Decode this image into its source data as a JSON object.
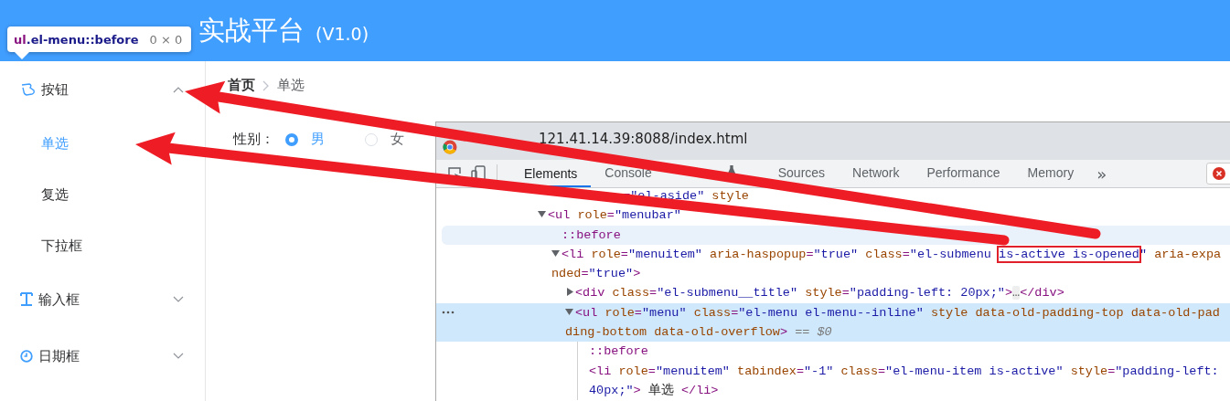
{
  "header": {
    "title": "实战平台",
    "version": "(V1.0)"
  },
  "inspect_tooltip": {
    "tag": "ul",
    "selector": ".el-menu::before",
    "size": "0 × 0"
  },
  "sidebar": {
    "items": [
      {
        "label": "按钮",
        "kind": "button",
        "expanded": true,
        "children": [
          {
            "label": "单选",
            "selected": true
          },
          {
            "label": "复选",
            "selected": false
          },
          {
            "label": "下拉框",
            "selected": false
          }
        ]
      },
      {
        "label": "输入框",
        "kind": "input",
        "expanded": false
      },
      {
        "label": "日期框",
        "kind": "date",
        "expanded": false
      }
    ]
  },
  "breadcrumb": [
    "首页",
    "单选"
  ],
  "form": {
    "label": "性别：",
    "options": [
      {
        "label": "男",
        "selected": true
      },
      {
        "label": "女",
        "selected": false
      }
    ]
  },
  "devtools": {
    "title": "121.41.14.39:8088/index.html",
    "tabs": [
      {
        "label": "Elements",
        "selected": true
      },
      {
        "label": "Console",
        "selected": false
      },
      {
        "selected": false,
        "kind": "experimental"
      },
      {
        "label": "Sources",
        "selected": false
      },
      {
        "label": "Network",
        "selected": false
      },
      {
        "label": "Performance",
        "selected": false
      },
      {
        "label": "Memory",
        "selected": false
      }
    ],
    "more": "»",
    "nodes": [
      {
        "selected": false,
        "hovered": false,
        "tokens": [
          {
            "kind": "gap"
          },
          {
            "kind": "gap"
          },
          {
            "kind": "gap"
          },
          {
            "kind": "gap"
          },
          {
            "kind": "gap"
          },
          {
            "kind": "gap"
          },
          {
            "kind": "gap"
          },
          {
            "kind": "gap"
          },
          {
            "kind": "gap"
          },
          {
            "kind": "gap"
          },
          {
            "kind": "gap"
          },
          {
            "kind": "gap"
          },
          {
            "kind": "punct",
            "text": "="
          },
          {
            "kind": "value",
            "text": "\"el-aside\""
          },
          {
            "kind": "attr",
            "text": " style"
          }
        ],
        "children": [
          {
            "expanded": true,
            "selected": false,
            "hovered": false,
            "tokens": [
              {
                "kind": "punct",
                "text": "<"
              },
              {
                "kind": "tag",
                "text": "ul"
              },
              {
                "kind": "attr",
                "text": " role"
              },
              {
                "kind": "punct",
                "text": "="
              },
              {
                "kind": "value",
                "text": "\"menubar\""
              }
            ],
            "children": [
              {
                "selected": false,
                "hovered": true,
                "tokens": [
                  {
                    "kind": "pseudo",
                    "text": "::before"
                  }
                ]
              },
              {
                "expanded": true,
                "selected": false,
                "hovered": false,
                "tokens": [
                  {
                    "kind": "punct",
                    "text": "<"
                  },
                  {
                    "kind": "tag",
                    "text": "li"
                  },
                  {
                    "kind": "attr",
                    "text": " role"
                  },
                  {
                    "kind": "punct",
                    "text": "="
                  },
                  {
                    "kind": "value",
                    "text": "\"menuitem\""
                  },
                  {
                    "kind": "attr",
                    "text": " aria-haspopup"
                  },
                  {
                    "kind": "punct",
                    "text": "="
                  },
                  {
                    "kind": "value",
                    "text": "\"true\""
                  },
                  {
                    "kind": "attr",
                    "text": " class"
                  },
                  {
                    "kind": "punct",
                    "text": "="
                  },
                  {
                    "kind": "value",
                    "text": "\"el-submenu "
                  },
                  {
                    "kind": "boxed",
                    "text": "is-active is-opened"
                  },
                  {
                    "kind": "value",
                    "text": "\""
                  },
                  {
                    "kind": "attr",
                    "text": " aria-expanded"
                  },
                  {
                    "kind": "punct",
                    "text": "="
                  },
                  {
                    "kind": "value",
                    "text": "\"true\""
                  },
                  {
                    "kind": "punct",
                    "text": ">"
                  }
                ],
                "children": [
                  {
                    "expanded": false,
                    "selected": false,
                    "hovered": false,
                    "tokens": [
                      {
                        "kind": "punct",
                        "text": "<"
                      },
                      {
                        "kind": "tag",
                        "text": "div"
                      },
                      {
                        "kind": "attr",
                        "text": " class"
                      },
                      {
                        "kind": "punct",
                        "text": "="
                      },
                      {
                        "kind": "value",
                        "text": "\"el-submenu__title\""
                      },
                      {
                        "kind": "attr",
                        "text": " style"
                      },
                      {
                        "kind": "punct",
                        "text": "="
                      },
                      {
                        "kind": "value",
                        "text": "\"padding-left: 20px;\""
                      },
                      {
                        "kind": "punct",
                        "text": ">"
                      },
                      {
                        "kind": "ellipsis",
                        "text": "…"
                      },
                      {
                        "kind": "punct",
                        "text": "</"
                      },
                      {
                        "kind": "tag",
                        "text": "div"
                      },
                      {
                        "kind": "punct",
                        "text": ">"
                      }
                    ]
                  },
                  {
                    "expanded": true,
                    "selected": true,
                    "hovered": false,
                    "tokens": [
                      {
                        "kind": "punct",
                        "text": "<"
                      },
                      {
                        "kind": "tag",
                        "text": "ul"
                      },
                      {
                        "kind": "attr",
                        "text": " role"
                      },
                      {
                        "kind": "punct",
                        "text": "="
                      },
                      {
                        "kind": "value",
                        "text": "\"menu\""
                      },
                      {
                        "kind": "attr",
                        "text": " class"
                      },
                      {
                        "kind": "punct",
                        "text": "="
                      },
                      {
                        "kind": "value",
                        "text": "\"el-menu el-menu--inline\""
                      },
                      {
                        "kind": "attr",
                        "text": " style data-old-padding-top data-old-padding-bottom data-old-overflow"
                      },
                      {
                        "kind": "punct",
                        "text": ">"
                      },
                      {
                        "kind": "ref",
                        "text": " == $0"
                      }
                    ],
                    "children": [
                      {
                        "selected": false,
                        "hovered": false,
                        "tokens": [
                          {
                            "kind": "pseudo",
                            "text": "::before"
                          }
                        ]
                      },
                      {
                        "selected": false,
                        "hovered": false,
                        "tokens": [
                          {
                            "kind": "punct",
                            "text": "<"
                          },
                          {
                            "kind": "tag",
                            "text": "li"
                          },
                          {
                            "kind": "attr",
                            "text": " role"
                          },
                          {
                            "kind": "punct",
                            "text": "="
                          },
                          {
                            "kind": "value",
                            "text": "\"menuitem\""
                          },
                          {
                            "kind": "attr",
                            "text": " tabindex"
                          },
                          {
                            "kind": "punct",
                            "text": "="
                          },
                          {
                            "kind": "value",
                            "text": "\"-1\""
                          },
                          {
                            "kind": "attr",
                            "text": " class"
                          },
                          {
                            "kind": "punct",
                            "text": "="
                          },
                          {
                            "kind": "value",
                            "text": "\"el-menu-item is-active\""
                          },
                          {
                            "kind": "attr",
                            "text": " style"
                          },
                          {
                            "kind": "punct",
                            "text": "="
                          },
                          {
                            "kind": "value",
                            "text": "\"padding-left: 40px;\""
                          },
                          {
                            "kind": "punct",
                            "text": ">"
                          },
                          {
                            "kind": "text",
                            "text": " 单选 "
                          },
                          {
                            "kind": "punct",
                            "text": "</"
                          },
                          {
                            "kind": "tag",
                            "text": "li"
                          },
                          {
                            "kind": "punct",
                            "text": ">"
                          }
                        ]
                      }
                    ]
                  }
                ]
              }
            ]
          }
        ]
      }
    ]
  }
}
